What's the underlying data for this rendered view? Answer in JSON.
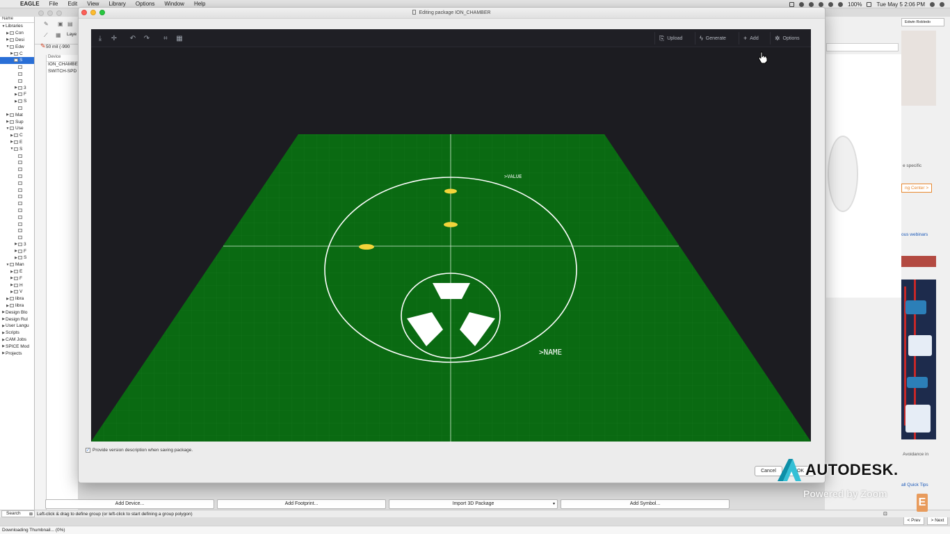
{
  "menubar": {
    "app": "EAGLE",
    "items": [
      "File",
      "Edit",
      "View",
      "Library",
      "Options",
      "Window",
      "Help"
    ],
    "battery": "100%",
    "clock": "Tue May 5  2:06 PM"
  },
  "tree": {
    "header": "Name",
    "rows": [
      {
        "label": "Libraries",
        "tw": "▼",
        "indent": 0
      },
      {
        "label": "Con",
        "tw": "▶",
        "indent": 1
      },
      {
        "label": "Desi",
        "tw": "▶",
        "indent": 1
      },
      {
        "label": "Edw",
        "tw": "▼",
        "indent": 1
      },
      {
        "label": "C",
        "tw": "▶",
        "indent": 2
      },
      {
        "label": "S",
        "tw": "",
        "indent": 2,
        "selected": true
      },
      {
        "label": "",
        "tw": "",
        "indent": 3
      },
      {
        "label": "",
        "tw": "",
        "indent": 3
      },
      {
        "label": "",
        "tw": "",
        "indent": 3
      },
      {
        "label": "3",
        "tw": "▶",
        "indent": 3
      },
      {
        "label": "F",
        "tw": "▶",
        "indent": 3
      },
      {
        "label": "S",
        "tw": "▶",
        "indent": 3
      },
      {
        "label": "",
        "tw": "",
        "indent": 3
      },
      {
        "label": "Mat",
        "tw": "▶",
        "indent": 1
      },
      {
        "label": "Sup",
        "tw": "▶",
        "indent": 1
      },
      {
        "label": "Use",
        "tw": "▼",
        "indent": 1
      },
      {
        "label": "C",
        "tw": "▶",
        "indent": 2
      },
      {
        "label": "E",
        "tw": "▶",
        "indent": 2
      },
      {
        "label": "S",
        "tw": "▼",
        "indent": 2
      },
      {
        "label": "",
        "tw": "",
        "indent": 3
      },
      {
        "label": "",
        "tw": "",
        "indent": 3
      },
      {
        "label": "",
        "tw": "",
        "indent": 3
      },
      {
        "label": "",
        "tw": "",
        "indent": 3
      },
      {
        "label": "",
        "tw": "",
        "indent": 3
      },
      {
        "label": "",
        "tw": "",
        "indent": 3
      },
      {
        "label": "",
        "tw": "",
        "indent": 3
      },
      {
        "label": "",
        "tw": "",
        "indent": 3
      },
      {
        "label": "",
        "tw": "",
        "indent": 3
      },
      {
        "label": "",
        "tw": "",
        "indent": 3
      },
      {
        "label": "",
        "tw": "",
        "indent": 3
      },
      {
        "label": "",
        "tw": "",
        "indent": 3
      },
      {
        "label": "",
        "tw": "",
        "indent": 3
      },
      {
        "label": "3",
        "tw": "▶",
        "indent": 3
      },
      {
        "label": "F",
        "tw": "▶",
        "indent": 3
      },
      {
        "label": "S",
        "tw": "▶",
        "indent": 3
      },
      {
        "label": "Man",
        "tw": "▼",
        "indent": 1
      },
      {
        "label": "E",
        "tw": "▶",
        "indent": 2
      },
      {
        "label": "F",
        "tw": "▶",
        "indent": 2
      },
      {
        "label": "H",
        "tw": "▶",
        "indent": 2
      },
      {
        "label": "V",
        "tw": "▶",
        "indent": 2
      },
      {
        "label": "libra",
        "tw": "▶",
        "indent": 1
      },
      {
        "label": "libra",
        "tw": "▶",
        "indent": 1
      },
      {
        "label": "Design Blo",
        "tw": "▶",
        "indent": 0
      },
      {
        "label": "Design Rul",
        "tw": "▶",
        "indent": 0
      },
      {
        "label": "User Langu",
        "tw": "▶",
        "indent": 0
      },
      {
        "label": "Scripts",
        "tw": "▶",
        "indent": 0
      },
      {
        "label": "CAM Jobs",
        "tw": "▶",
        "indent": 0
      },
      {
        "label": "SPICE Mod",
        "tw": "▶",
        "indent": 0
      },
      {
        "label": "Projects",
        "tw": "▶",
        "indent": 0
      }
    ]
  },
  "sidepane": {
    "layer_label": "Laye",
    "grid_label": "50 mil (-990",
    "list_header": "Device",
    "devices": [
      "ION_CHAMBE",
      "SWITCH-SPD"
    ]
  },
  "dialog": {
    "title": "Editing package ION_CHAMBER",
    "toolbar": {
      "upload": "Upload",
      "generate": "Generate",
      "add": "Add",
      "options": "Options"
    },
    "silk": {
      "value_label": ">VALUE",
      "name_label": ">NAME"
    },
    "version_checkbox_label": "Provide version description when saving package.",
    "cancel_label": "Cancel",
    "ok_label": "OK"
  },
  "bottom_buttons": {
    "add_device": "Add Device...",
    "add_footprint": "Add Footprint...",
    "import_3d": "Import 3D Package",
    "add_symbol": "Add Symbol..."
  },
  "status": {
    "search": "Search",
    "message": "Left-click & drag to define group (or left-click to start defining a group polygon)",
    "download": "Downloading Thumbnail... (0%)"
  },
  "right_panel": {
    "user": "Edwin Robledo",
    "specific": "e specific",
    "learning_center": "ng Center >",
    "webinars": "ous webinars",
    "avoidance": "Avoidance in",
    "quick_tips": "all Quick Tips",
    "prev": "< Prev",
    "next": "> Next"
  },
  "overlay": {
    "brand": "AUTODESK.",
    "powered": "Powered by Zoom",
    "badge": "E"
  },
  "colors": {
    "board": "#0a6a12",
    "viewer_bg": "#1c1c21",
    "pad": "#f2d43a",
    "silk": "#ffffff",
    "selection": "#2a6fd6"
  }
}
